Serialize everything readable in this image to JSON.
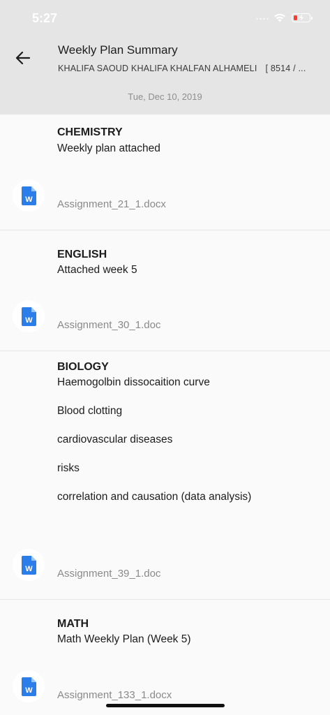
{
  "status_bar": {
    "time": "5:27"
  },
  "header": {
    "title": "Weekly Plan Summary",
    "student_name": "KHALIFA SAOUD KHALIFA KHALFAN ALHAMELI",
    "student_id": "[ 8514 / ...",
    "date": "Tue, Dec 10, 2019"
  },
  "plans": [
    {
      "subject": "CHEMISTRY",
      "notes": [
        "Weekly plan attached"
      ],
      "file": "Assignment_21_1.docx"
    },
    {
      "subject": "ENGLISH",
      "notes": [
        "Attached week 5"
      ],
      "file": "Assignment_30_1.doc"
    },
    {
      "subject": "BIOLOGY",
      "notes": [
        "Haemogolbin dissocaition curve",
        "Blood clotting",
        "cardiovascular diseases",
        "risks",
        "correlation and causation (data analysis)"
      ],
      "file": "Assignment_39_1.doc"
    },
    {
      "subject": "MATH",
      "notes": [
        "Math Weekly Plan (Week 5)"
      ],
      "file": "Assignment_133_1.docx"
    }
  ],
  "icons": {
    "back": "arrow-left-icon",
    "file": "word-document-icon",
    "word_letter": "W"
  },
  "colors": {
    "header_bg": "#e5e5e5",
    "word_blue": "#2b7de9",
    "battery_low": "#ff3b30"
  }
}
